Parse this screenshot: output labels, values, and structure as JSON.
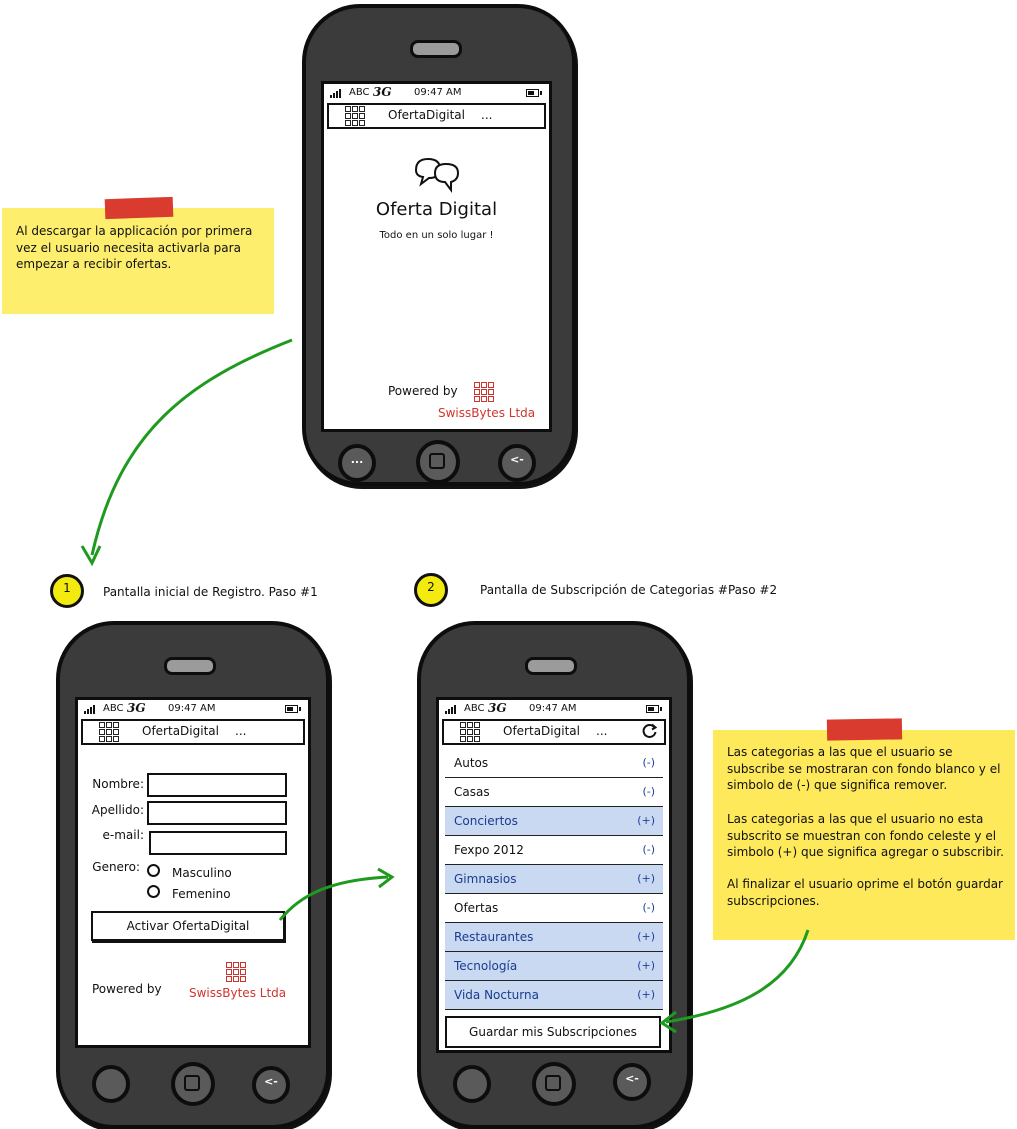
{
  "status_bar": {
    "carrier": "ABC",
    "network": "3G",
    "time": "09:47 AM"
  },
  "app_name": "OfertaDigital",
  "menu_dots": "...",
  "splash": {
    "title": "Oferta Digital",
    "tagline": "Todo en un solo lugar !",
    "powered_by": "Powered by",
    "company": "SwissBytes Ltda"
  },
  "hardware_buttons": {
    "menu": "...",
    "back": "<-"
  },
  "note_top": "Al descargar la applicación por primera vez el usuario necesita activarla para empezar a recibir ofertas.",
  "step1": {
    "number": "1",
    "label": "Pantalla inicial de Registro. Paso #1",
    "fields": {
      "nombre": "Nombre:",
      "apellido": "Apellido:",
      "email": "e-mail:"
    },
    "genero": "Genero:",
    "options": [
      "Masculino",
      "Femenino"
    ],
    "button": "Activar OfertaDigital",
    "powered_by": "Powered by",
    "company": "SwissBytes Ltda"
  },
  "step2": {
    "number": "2",
    "label": "Pantalla de Subscripción de Categorias #Paso #2",
    "categories": [
      {
        "name": "Autos",
        "symbol": "(-)",
        "subscribed": true
      },
      {
        "name": "Casas",
        "symbol": "(-)",
        "subscribed": true
      },
      {
        "name": "Conciertos",
        "symbol": "(+)",
        "subscribed": false
      },
      {
        "name": "Fexpo 2012",
        "symbol": "(-)",
        "subscribed": true
      },
      {
        "name": "Gimnasios",
        "symbol": "(+)",
        "subscribed": false
      },
      {
        "name": "Ofertas",
        "symbol": "(-)",
        "subscribed": true
      },
      {
        "name": "Restaurantes",
        "symbol": "(+)",
        "subscribed": false
      },
      {
        "name": "Tecnología",
        "symbol": "(+)",
        "subscribed": false
      },
      {
        "name": "Vida Nocturna",
        "symbol": "(+)",
        "subscribed": false
      }
    ],
    "save_button": "Guardar mis Subscripciones"
  },
  "note_right": {
    "p1": "Las categorias a las que el usuario se subscribe se mostraran con fondo blanco y el simbolo de (-) que significa remover.",
    "p2": "Las categorias a las que el usuario no esta subscrito se muestran con fondo celeste y el simbolo (+) que significa agregar o subscribir.",
    "p3": "Al finalizar el usuario oprime el botón guardar subscripciones."
  },
  "colors": {
    "arrow": "#1e9b1e",
    "note": "#fde95a",
    "tape": "#d93b2e",
    "unsubscribed_row": "#c9d9f2",
    "brand_red": "#d0342c"
  }
}
